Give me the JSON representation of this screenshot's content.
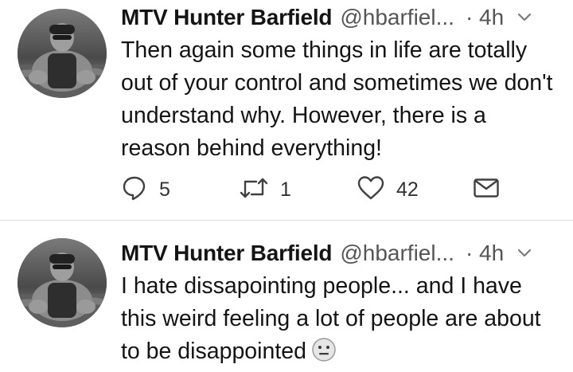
{
  "tweets": [
    {
      "display_name": "MTV Hunter Barfield",
      "handle": "@hbarfiel...",
      "time": "· 4h",
      "text": "Then again some things in life are totally out of your control and sometimes we don't understand why. However, there is a reason behind everything!",
      "reply_count": "5",
      "retweet_count": "1",
      "like_count": "42",
      "icons": {
        "avatar": "profile-photo",
        "menu": "chevron-down-icon",
        "reply": "reply-icon",
        "retweet": "retweet-icon",
        "like": "heart-icon",
        "dm": "envelope-icon"
      }
    },
    {
      "display_name": "MTV Hunter Barfield",
      "handle": "@hbarfiel...",
      "time": "· 4h",
      "text": "I hate dissapointing people... and I have this weird feeling a lot of people are about to be disappointed",
      "emoji": "neutral-face-emoji",
      "icons": {
        "avatar": "profile-photo",
        "menu": "chevron-down-icon"
      }
    }
  ],
  "colors": {
    "text": "#141414",
    "muted": "#555555",
    "divider": "#dcdcdc",
    "icon": "#404040"
  }
}
